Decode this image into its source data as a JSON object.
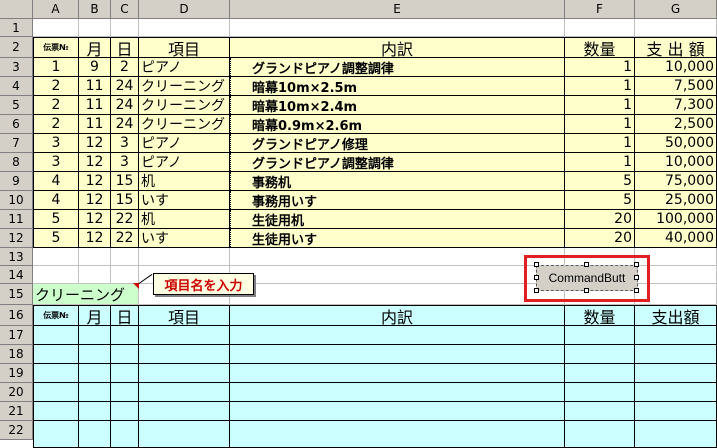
{
  "columns": [
    "A",
    "B",
    "C",
    "D",
    "E",
    "F",
    "G"
  ],
  "rows": [
    "1",
    "2",
    "3",
    "4",
    "5",
    "6",
    "7",
    "8",
    "9",
    "10",
    "11",
    "12",
    "13",
    "14",
    "15",
    "16",
    "17",
    "18",
    "19",
    "20",
    "21",
    "22"
  ],
  "table1": {
    "headers": {
      "slip": "伝票№",
      "month": "月",
      "day": "日",
      "item": "項目",
      "desc": "内訳",
      "qty": "数量",
      "amount": "支 出 額"
    },
    "data": [
      [
        "1",
        "9",
        "2",
        "ピアノ",
        "グランドピアノ調整調律",
        "1",
        "10,000"
      ],
      [
        "2",
        "11",
        "24",
        "クリーニング",
        "暗幕10m×2.5m",
        "1",
        "7,500"
      ],
      [
        "2",
        "11",
        "24",
        "クリーニング",
        "暗幕10m×2.4m",
        "1",
        "7,300"
      ],
      [
        "2",
        "11",
        "24",
        "クリーニング",
        "暗幕0.9m×2.6m",
        "1",
        "2,500"
      ],
      [
        "3",
        "12",
        "3",
        "ピアノ",
        "グランドピアノ修理",
        "1",
        "50,000"
      ],
      [
        "3",
        "12",
        "3",
        "ピアノ",
        "グランドピアノ調整調律",
        "1",
        "10,000"
      ],
      [
        "4",
        "12",
        "15",
        "机",
        "事務机",
        "5",
        "75,000"
      ],
      [
        "4",
        "12",
        "15",
        "いす",
        "事務用いす",
        "5",
        "25,000"
      ],
      [
        "5",
        "12",
        "22",
        "机",
        "生徒用机",
        "20",
        "100,000"
      ],
      [
        "5",
        "12",
        "22",
        "いす",
        "生徒用いす",
        "20",
        "40,000"
      ]
    ]
  },
  "filter_value": "クリーニング",
  "comment_text": "項目名を入力",
  "command_button_label": "CommandButt",
  "table2": {
    "headers": {
      "slip": "伝票№",
      "month": "月",
      "day": "日",
      "item": "項目",
      "desc": "内訳",
      "qty": "数量",
      "amount": "支出額"
    }
  }
}
